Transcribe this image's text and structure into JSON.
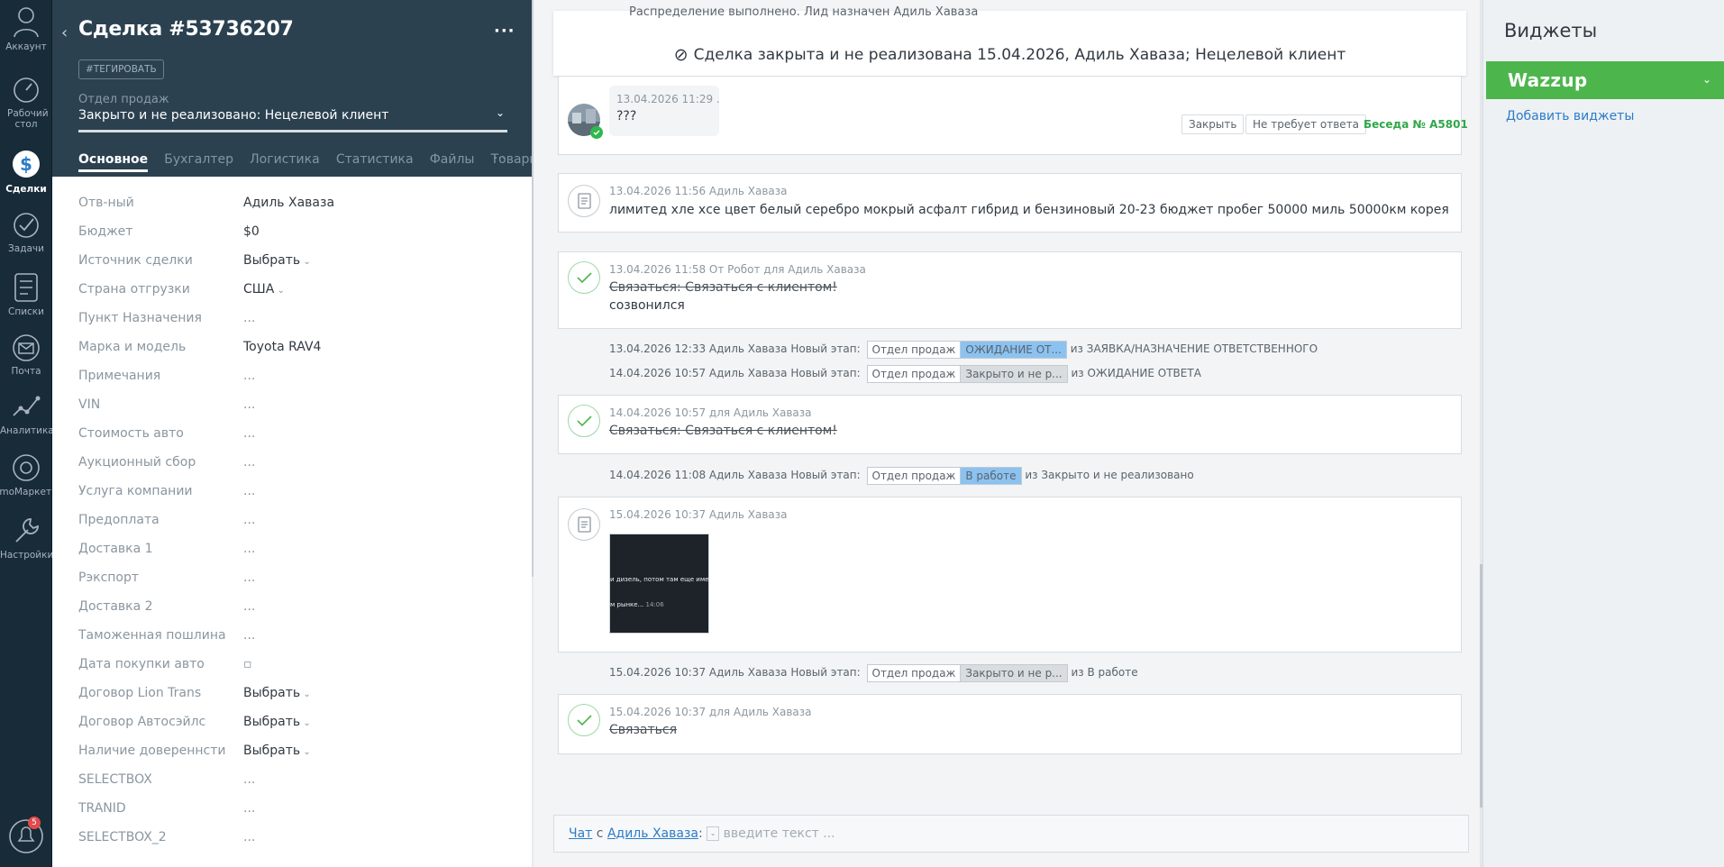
{
  "rail": {
    "items": [
      {
        "label": "Аккаунт",
        "icon": "account-icon"
      },
      {
        "label": "Рабочий стол",
        "icon": "dashboard-icon"
      },
      {
        "label": "Сделки",
        "icon": "deals-icon"
      },
      {
        "label": "Задачи",
        "icon": "tasks-icon"
      },
      {
        "label": "Списки",
        "icon": "lists-icon"
      },
      {
        "label": "Почта",
        "icon": "mail-icon"
      },
      {
        "label": "Аналитика",
        "icon": "analytics-icon"
      },
      {
        "label": "amoМаркет",
        "icon": "market-icon"
      },
      {
        "label": "Настройки",
        "icon": "settings-icon"
      }
    ],
    "notifications_count": "5"
  },
  "card": {
    "title": "Сделка #53736207",
    "tag_button": "#ТЕГИРОВАТЬ",
    "pipeline": "Отдел продаж",
    "status": "Закрыто и не реализовано: Нецелевой клиент",
    "tabs": [
      "Основное",
      "Бухгалтер",
      "Логистика",
      "Статистика",
      "Файлы",
      "Товары"
    ],
    "tabs_more": "···",
    "fields": [
      {
        "label": "Отв-ный",
        "value": "Адиль Хаваза"
      },
      {
        "label": "Бюджет",
        "value": "$0"
      },
      {
        "label": "Источник сделки",
        "value": "Выбрать"
      },
      {
        "label": "Страна отгрузки",
        "value": "США"
      },
      {
        "label": "Пункт Назначения",
        "value": "..."
      },
      {
        "label": "Марка и модель",
        "value": "Toyota RAV4"
      },
      {
        "label": "Примечания",
        "value": "..."
      },
      {
        "label": "VIN",
        "value": "..."
      },
      {
        "label": "Стоимость авто",
        "value": "..."
      },
      {
        "label": "Аукционный сбор",
        "value": "..."
      },
      {
        "label": "Услуга компании",
        "value": "..."
      },
      {
        "label": "Предоплата",
        "value": "..."
      },
      {
        "label": "Доставка 1",
        "value": "..."
      },
      {
        "label": "Рэкспорт",
        "value": "..."
      },
      {
        "label": "Доставка 2",
        "value": "..."
      },
      {
        "label": "Таможенная пошлина",
        "value": "..."
      },
      {
        "label": "Дата покупки авто",
        "value": "▫"
      },
      {
        "label": "Договор Lion Trans",
        "value": "Выбрать"
      },
      {
        "label": "Договор Автосэйлс",
        "value": "Выбрать"
      },
      {
        "label": "Наличие довереннсти",
        "value": "Выбрать"
      },
      {
        "label": "SELECTBOX",
        "value": "..."
      },
      {
        "label": "TRANID",
        "value": "..."
      },
      {
        "label": "SELECTBOX_2",
        "value": "..."
      }
    ]
  },
  "feed": {
    "top_cut_text": "Распределение выполнено. Лид назначен Адиль Хаваза",
    "closed_banner": "Сделка закрыта и не реализована 15.04.2026, Адиль Хаваза; Нецелевой клиент",
    "chat_message": {
      "meta": "13.04.2026 11:29 .",
      "text": "???",
      "close_btn": "Закрыть",
      "no_reply_btn": "Не требует ответа",
      "chat_link": "Беседа № A5801"
    },
    "note1": {
      "meta": "13.04.2026 11:56 Адиль Хаваза",
      "text": "лимитед хле хсе цвет белый серебро мокрый асфалт гибрид и бензиновый 20-23 бюджет пробег 50000 миль 50000км корея"
    },
    "task1": {
      "meta": "13.04.2026 11:58  От Робот для Адиль Хаваза",
      "title": "Связаться: Связаться с клиентом!",
      "result": "созвонился"
    },
    "stage1": {
      "prefix": "13.04.2026 12:33 Адиль Хаваза Новый этап:",
      "pipe": "Отдел продаж",
      "stage": "ОЖИДАНИЕ ОТ...",
      "suffix": "из ЗАЯВКА/НАЗНАЧЕНИЕ ОТВЕТСТВЕННОГО"
    },
    "stage2": {
      "prefix": "14.04.2026 10:57 Адиль Хаваза Новый этап:",
      "pipe": "Отдел продаж",
      "stage": "Закрыто и не р...",
      "suffix": "из ОЖИДАНИЕ ОТВЕТА"
    },
    "task2": {
      "meta": "14.04.2026 10:57  для Адиль Хаваза",
      "title": "Связаться: Связаться с клиентом!"
    },
    "stage3": {
      "prefix": "14.04.2026 11:08 Адиль Хаваза Новый этап:",
      "pipe": "Отдел продаж",
      "stage": "В работе",
      "suffix": "из Закрыто и не реализовано"
    },
    "note2": {
      "meta": "15.04.2026 10:37 Адиль Хаваза",
      "image_line1": "и дизель, потом там еще имеются",
      "image_line2": "м рынке...",
      "image_time": "14:06"
    },
    "stage4": {
      "prefix": "15.04.2026 10:37 Адиль Хаваза Новый этап:",
      "pipe": "Отдел продаж",
      "stage": "Закрыто и не р...",
      "suffix": "из В работе"
    },
    "task3": {
      "meta": "15.04.2026 10:37  для Адиль Хаваза",
      "title": "Связаться"
    },
    "composer": {
      "chat": "Чат",
      "with": "с",
      "user": "Адиль Хаваза",
      "colon": ":",
      "placeholder": "введите текст ..."
    }
  },
  "widgets": {
    "title": "Виджеты",
    "wazzup": "Wazzup",
    "add_link": "Добавить виджеты"
  },
  "colors": {
    "accent_green": "#4cb64c",
    "link_blue": "#2c7cc9",
    "stage_blue": "#8cc2f0",
    "stage_gray": "#d9dde0"
  }
}
